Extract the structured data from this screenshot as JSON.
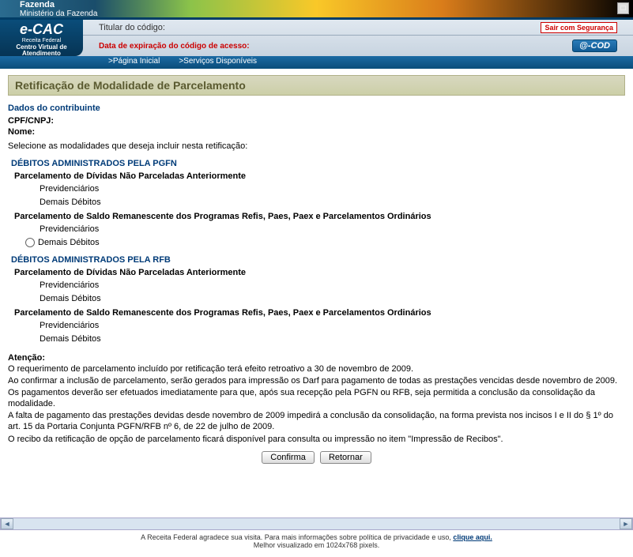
{
  "header": {
    "ministry_bold": "Fazenda",
    "ministry_sub": "Ministério da Fazenda",
    "ecac": "e-CAC",
    "receita": "Receita Federal",
    "centro": "Centro Virtual de Atendimento",
    "titular_label": "Titular do código:",
    "sair": "Sair com Segurança",
    "expira": "Data de expiração do código de acesso:",
    "ecod": "@-COD",
    "nav_home": ">Página Inicial",
    "nav_serv": ">Serviços Disponíveis"
  },
  "page": {
    "title": "Retificação de Modalidade de Parcelamento",
    "dados": "Dados do contribuinte",
    "cpf": "CPF/CNPJ:",
    "nome": "Nome:",
    "instr": "Selecione as modalidades que deseja incluir nesta retificação:"
  },
  "cats": {
    "pgfn": "DÉBITOS ADMINISTRADOS PELA PGFN",
    "rfb": "DÉBITOS ADMINISTRADOS PELA RFB",
    "sub1": "Parcelamento de Dívidas Não Parceladas Anteriormente",
    "sub2": "Parcelamento de Saldo Remanescente dos Programas Refis, Paes, Paex e Parcelamentos Ordinários",
    "opt_prev": "Previdenciários",
    "opt_dem": "Demais Débitos"
  },
  "att": {
    "label": "Atenção:",
    "p1": "O requerimento de parcelamento incluído por retificação terá efeito retroativo a 30 de novembro de 2009.",
    "p2": "Ao confirmar a inclusão de parcelamento, serão gerados para impressão os Darf para pagamento de todas as prestações vencidas desde novembro de 2009. Os pagamentos deverão ser efetuados imediatamente para que, após sua recepção pela PGFN ou RFB, seja permitida a conclusão da consolidação da modalidade.",
    "p3": "A falta de pagamento das prestações devidas desde novembro de 2009 impedirá a conclusão da consolidação, na forma prevista nos incisos I e II do § 1º do art. 15 da Portaria Conjunta PGFN/RFB nº 6, de 22 de julho de 2009.",
    "p4": "O recibo da retificação de opção de parcelamento ficará disponível para consulta ou impressão no item \"Impressão de Recibos\"."
  },
  "btn": {
    "confirma": "Confirma",
    "retornar": "Retornar"
  },
  "footer": {
    "l1a": "A Receita Federal agradece sua visita. Para mais informações sobre política de privacidade e uso, ",
    "l1b": "clique aqui.",
    "l2": "Melhor visualizado em 1024x768 pixels."
  }
}
